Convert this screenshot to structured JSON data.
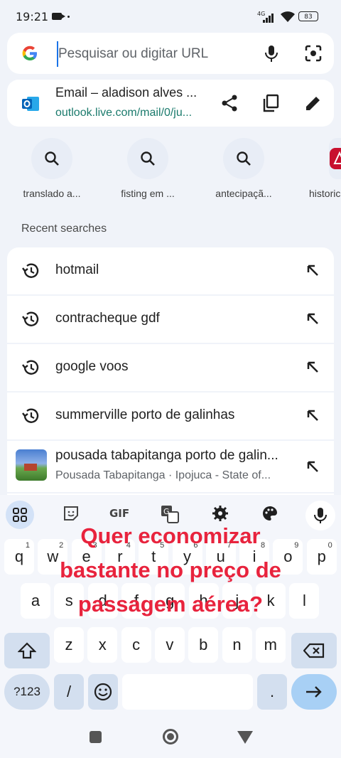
{
  "status_bar": {
    "time": "19:21",
    "network": "4G",
    "battery": "83"
  },
  "search": {
    "placeholder": "Pesquisar ou digitar URL"
  },
  "current_tab": {
    "title": "Email – aladison alves ...",
    "url": "outlook.live.com/mail/0/ju..."
  },
  "shortcuts": [
    {
      "label": "translado a..."
    },
    {
      "label": "fisting em ..."
    },
    {
      "label": "antecipaçã..."
    },
    {
      "label": "historic"
    }
  ],
  "recent": {
    "title": "Recent searches",
    "items": [
      {
        "text": "hotmail"
      },
      {
        "text": "contracheque gdf"
      },
      {
        "text": "google voos"
      },
      {
        "text": "summerville porto de galinhas"
      },
      {
        "text": "pousada tabapitanga porto de galin...",
        "sub": "Pousada Tabapitanga · Ipojuca - State of..."
      }
    ]
  },
  "keyboard": {
    "toolbar": {
      "gif": "GIF"
    },
    "row1": [
      {
        "k": "q",
        "n": "1"
      },
      {
        "k": "w",
        "n": "2"
      },
      {
        "k": "e",
        "n": "3"
      },
      {
        "k": "r",
        "n": "4"
      },
      {
        "k": "t",
        "n": "5"
      },
      {
        "k": "y",
        "n": "6"
      },
      {
        "k": "u",
        "n": "7"
      },
      {
        "k": "i",
        "n": "8"
      },
      {
        "k": "o",
        "n": "9"
      },
      {
        "k": "p",
        "n": "0"
      }
    ],
    "row2": [
      "a",
      "s",
      "d",
      "f",
      "g",
      "h",
      "j",
      "k",
      "l"
    ],
    "row3": [
      "z",
      "x",
      "c",
      "v",
      "b",
      "n",
      "m"
    ],
    "row4": {
      "sym": "?123",
      "slash": "/",
      "period": "."
    }
  },
  "overlay": {
    "line1": "Quer economizar",
    "line2": "bastante no preço de",
    "line3": "passagem aérea?"
  },
  "colors": {
    "accent": "#1a73e8",
    "overlay_text": "#e8233d",
    "url_green": "#1a7a6c"
  }
}
